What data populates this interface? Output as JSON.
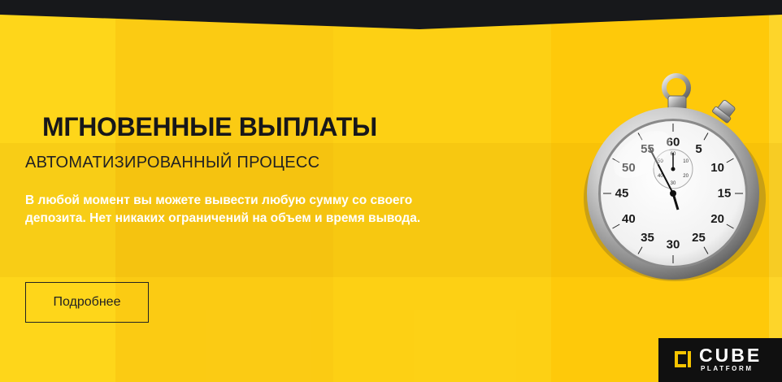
{
  "banner": {
    "title": "МГНОВЕННЫЕ ВЫПЛАТЫ",
    "subtitle": "АВТОМАТИЗИРОВАННЫЙ ПРОЦЕСС",
    "description_line1": "В любой момент вы можете вывести любую сумму со своего",
    "description_line2": "депозита. Нет никаких ограничений на объем и время вывода.",
    "more_button": "Подробнее"
  },
  "stopwatch": {
    "icon": "stopwatch-icon",
    "dial_numbers": [
      "60",
      "5",
      "10",
      "15",
      "20",
      "25",
      "30",
      "35",
      "40",
      "45",
      "50",
      "55"
    ],
    "small_dial_numbers": [
      "60",
      "10",
      "20",
      "30",
      "40",
      "50"
    ]
  },
  "logo": {
    "word1": "CUBE",
    "word2": "PLATFORM",
    "icon": "cube-logo-icon"
  },
  "colors": {
    "background": "#fdd20c",
    "top_bar": "#17181b",
    "title": "#17171a",
    "description": "#ffffff",
    "logo_background": "#101010",
    "logo_accent": "#f6c400"
  }
}
